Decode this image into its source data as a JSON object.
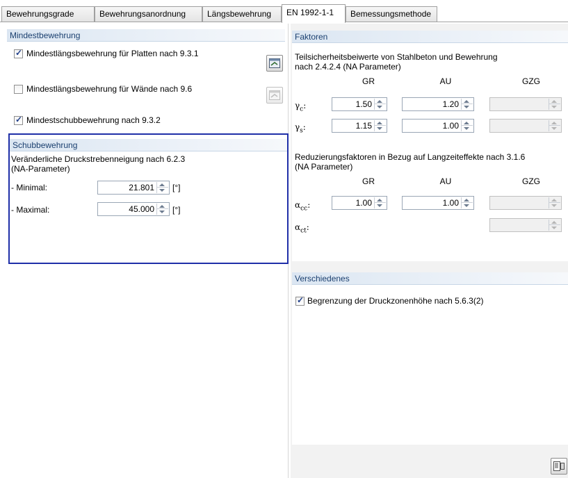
{
  "tabs": [
    "Bewehrungsgrade",
    "Bewehrungsanordnung",
    "Längsbewehrung",
    "EN 1992-1-1",
    "Bemessungsmethode"
  ],
  "mindest": {
    "header": "Mindestbewehrung",
    "items": [
      {
        "label": "Mindestlängsbewehrung für Platten nach 9.3.1",
        "checked": true
      },
      {
        "label": "Mindestlängsbewehrung für Wände nach 9.6",
        "checked": false
      },
      {
        "label": "Mindestschubbewehrung nach 9.3.2",
        "checked": true
      }
    ]
  },
  "schub": {
    "header": "Schubbewehrung",
    "desc_line1": "Veränderliche Druckstrebenneigung nach 6.2.3",
    "desc_line2": "(NA-Parameter)",
    "min_label": "- Minimal:",
    "min_value": "21.801",
    "max_label": "- Maximal:",
    "max_value": "45.000",
    "unit": "[°]"
  },
  "faktoren": {
    "header": "Faktoren",
    "desc1_line1": "Teilsicherheitsbeiwerte von Stahlbeton und Bewehrung",
    "desc1_line2": "nach 2.4.2.4 (NA Parameter)",
    "cols": [
      "GR",
      "AU",
      "GZG"
    ],
    "gamma_c": {
      "symbol": "γ",
      "sub": "c",
      "gr": "1.50",
      "au": "1.20"
    },
    "gamma_s": {
      "symbol": "γ",
      "sub": "s",
      "gr": "1.15",
      "au": "1.00"
    },
    "desc2_line1": "Reduzierungsfaktoren in Bezug auf Langzeiteffekte nach 3.1.6",
    "desc2_line2": "(NA Parameter)",
    "alpha_cc": {
      "symbol": "α",
      "sub": "cc",
      "gr": "1.00",
      "au": "1.00"
    },
    "alpha_ct": {
      "symbol": "α",
      "sub": "ct"
    },
    "colon": ":"
  },
  "verschiedenes": {
    "header": "Verschiedenes",
    "item": {
      "label": "Begrenzung der Druckzonenhöhe nach 5.6.3(2)",
      "checked": true
    }
  },
  "colors": {
    "accent": "#1a3f6f",
    "header_bg": "#dbe6f2",
    "highlight_border": "#1f2fa8"
  }
}
